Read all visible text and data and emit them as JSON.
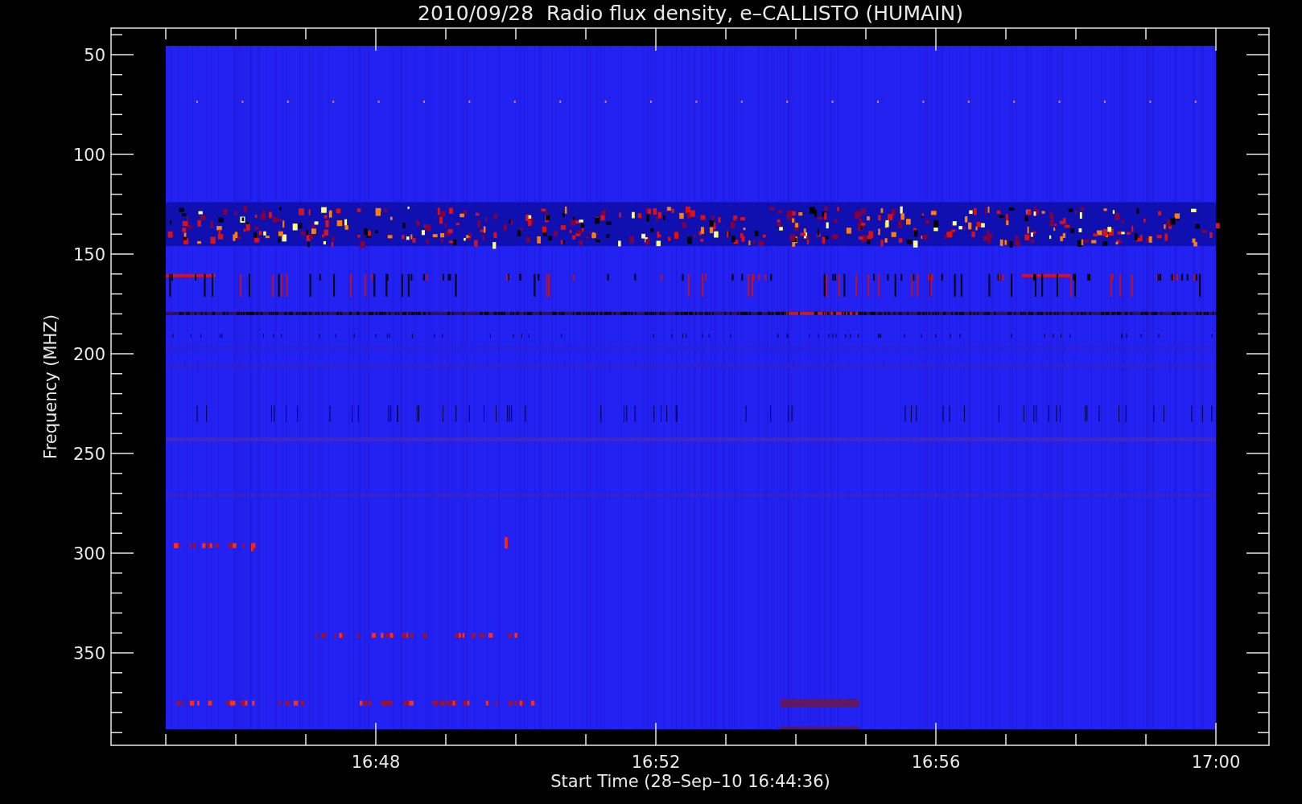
{
  "plot": {
    "title": "2010/09/28  Radio flux density, e–CALLISTO (HUMAIN)",
    "ylabel": "Frequency (MHZ)",
    "xlabel": "Start Time (28–Sep–10 16:44:36)",
    "yticks": [
      "50",
      "100",
      "150",
      "200",
      "250",
      "300",
      "350"
    ],
    "xticks": [
      "16:48",
      "16:52",
      "16:56",
      "17:00"
    ]
  }
}
